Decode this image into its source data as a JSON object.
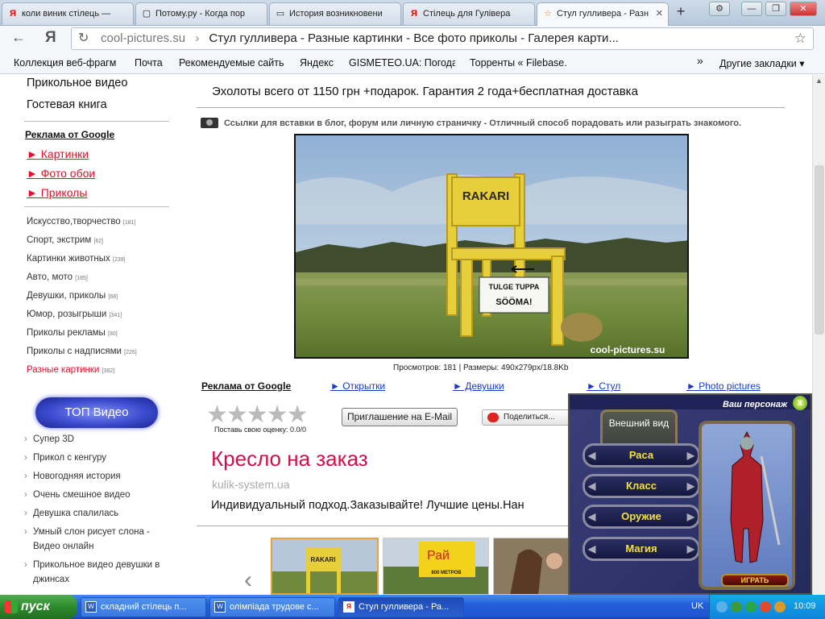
{
  "browser": {
    "tabs": [
      {
        "favicon": "Я",
        "title": "коли виник стілець —"
      },
      {
        "favicon": "▢",
        "title": "Потому.ру - Когда пор"
      },
      {
        "favicon": "▭",
        "title": "История возникновени"
      },
      {
        "favicon": "Я",
        "title": "Стілець для Гулівера"
      },
      {
        "favicon": "☆",
        "title": "Стул гулливера - Разн"
      }
    ],
    "new_tab": "+",
    "window_controls": [
      "⚙",
      "—",
      "❐",
      "✕"
    ],
    "nav": {
      "back": "←",
      "logo": "Я"
    },
    "address": {
      "domain": "cool-pictures.su",
      "separator": "›",
      "page_title": "Стул гулливера - Разные картинки - Все фото приколы - Галерея карти..."
    },
    "bookmarks": [
      "Коллекция веб-фрагм",
      "Почта",
      "Рекомендуемые сайть",
      "Яндекс",
      "GISMETEO.UA: Погода",
      "Торренты « Filebase.",
      "»",
      "Другие закладки ▾"
    ]
  },
  "sidebar": {
    "top_links": [
      "Прикольное видео",
      "Гостевая книга"
    ],
    "google_ads_label": "Реклама от Google",
    "red_links": [
      "► Картинки",
      "► Фото обои",
      "► Приколы"
    ],
    "categories": [
      {
        "name": "Искусство,творчество",
        "count": "[181]"
      },
      {
        "name": "Спорт, экстрим",
        "count": "[62]"
      },
      {
        "name": "Картинки животных",
        "count": "[239]"
      },
      {
        "name": "Авто, мото",
        "count": "[185]"
      },
      {
        "name": "Девушки, приколы",
        "count": "[68]"
      },
      {
        "name": "Юмор, розыгрыши",
        "count": "[341]"
      },
      {
        "name": "Приколы рекламы",
        "count": "[80]"
      },
      {
        "name": "Приколы с надписями",
        "count": "[226]"
      },
      {
        "name": "Разные картинки",
        "count": "[382]"
      }
    ],
    "top_video_label": "ТОП Видео",
    "videos": [
      "Супер 3D",
      "Прикол с кенгуру",
      "Новогодняя история",
      "Очень смешное видео",
      "Девушка спалилась",
      "Умный слон рисует слона - Видео онлайн",
      "Прикольное видео девушки в джинсах"
    ]
  },
  "main": {
    "promo_text": "Эхолоты всего от 1150 грн +подарок. Гарантия 2 года+бесплатная доставка",
    "embed_text": "Ссылки для вставки в блог, форум или личную страничку - Отличный способ порадовать или разыграть знакомого.",
    "photo": {
      "chair_sign": "RAKARI",
      "sign_line1": "TULGE TUPPA",
      "sign_line2": "SÖÖMA!",
      "watermark": "cool-pictures.su"
    },
    "photo_info": "Просмотров: 181 | Размеры: 490x279px/18.8Kb",
    "google_ads_label": "Реклама от Google",
    "ad_links": [
      "► Открытки",
      "► Девушки",
      "► Стул",
      "► Photo pictures"
    ],
    "rating": {
      "stars": "★★★★★",
      "caption": "Поставь свою оценку: 0.0/0"
    },
    "invite_button": "Приглашение на E-Mail",
    "share_button": "Поделиться...",
    "ad": {
      "title": "Кресло на заказ",
      "domain": "kulik-system.ua",
      "text": "Индивидуальный подход.Заказывайте! Лучшие цены.Нан"
    },
    "thumbs": [
      {
        "label": "RAKARI"
      },
      {
        "label": "Рай",
        "sub": "800 МЕТРОВ"
      },
      {
        "label": ""
      }
    ]
  },
  "game_ad": {
    "header": "Ваш персонаж",
    "close": "x",
    "panel_title": "Внешний вид",
    "buttons": [
      "Раса",
      "Класс",
      "Оружие",
      "Магия"
    ],
    "play": "ИГРАТЬ"
  },
  "taskbar": {
    "start": "пуск",
    "tasks": [
      "складний стілець п...",
      "олімпіада трудове с...",
      "Стул гулливера - Ра..."
    ],
    "lang": "UK",
    "time": "10:09"
  },
  "colors": {
    "link_red": "#e0102a",
    "link_blue": "#1a37c8",
    "ad_title": "#d0104a",
    "taskbar": "#245edb"
  }
}
